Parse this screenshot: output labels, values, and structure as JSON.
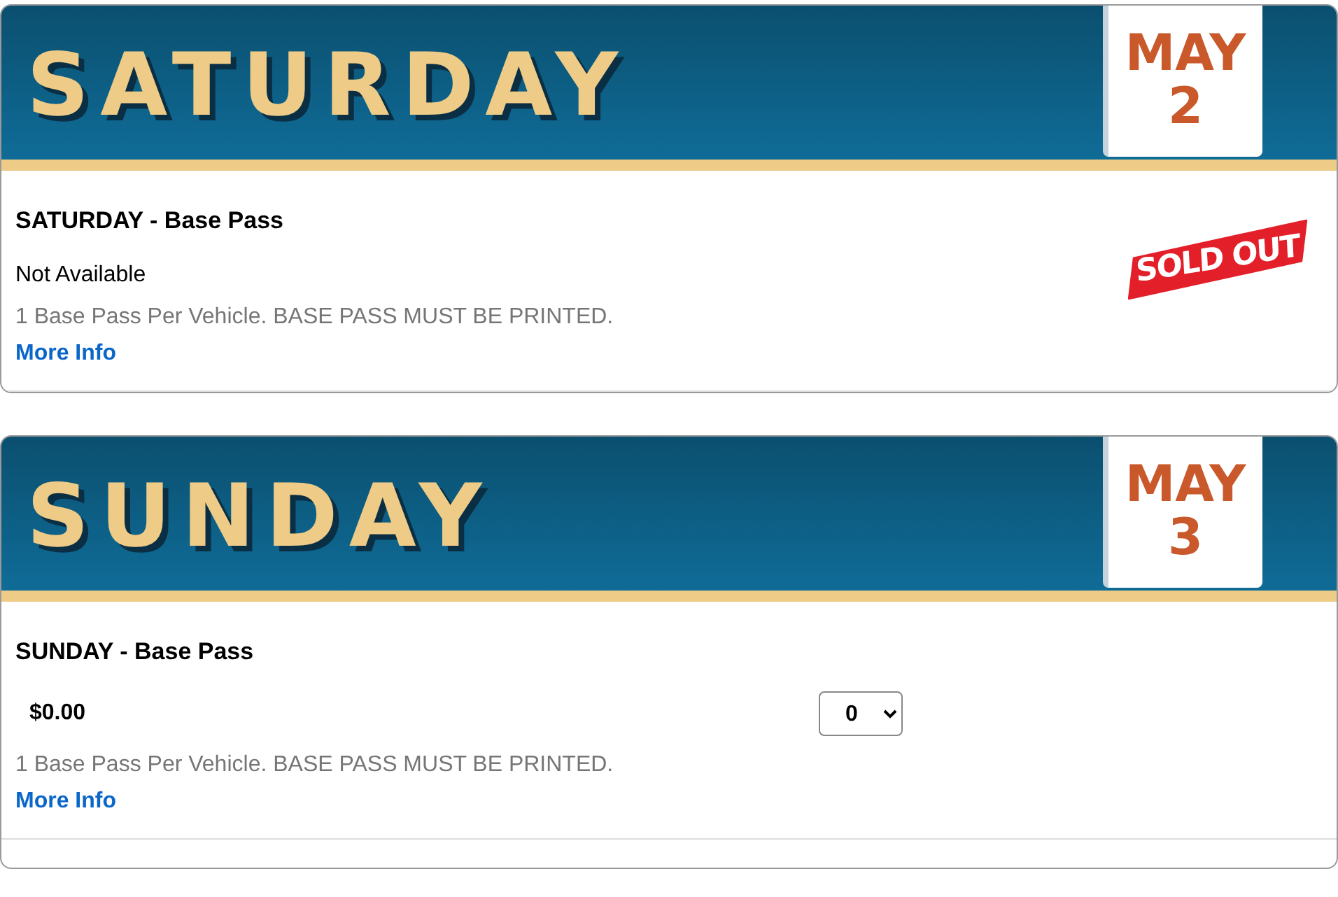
{
  "days": [
    {
      "day": "SATURDAY",
      "month": "MAY",
      "date": "2",
      "title": "SATURDAY - Base Pass",
      "kind": "sold_out",
      "status": "Not Available",
      "stamp": "SOLD OUT",
      "description": "1 Base Pass Per Vehicle. BASE PASS MUST BE PRINTED.",
      "link": "More Info"
    },
    {
      "day": "SUNDAY",
      "month": "MAY",
      "date": "3",
      "title": "SUNDAY - Base Pass",
      "kind": "available",
      "price": "$0.00",
      "quantity": "0",
      "description": "1 Base Pass Per Vehicle. BASE PASS MUST BE PRINTED.",
      "link": "More Info"
    }
  ]
}
